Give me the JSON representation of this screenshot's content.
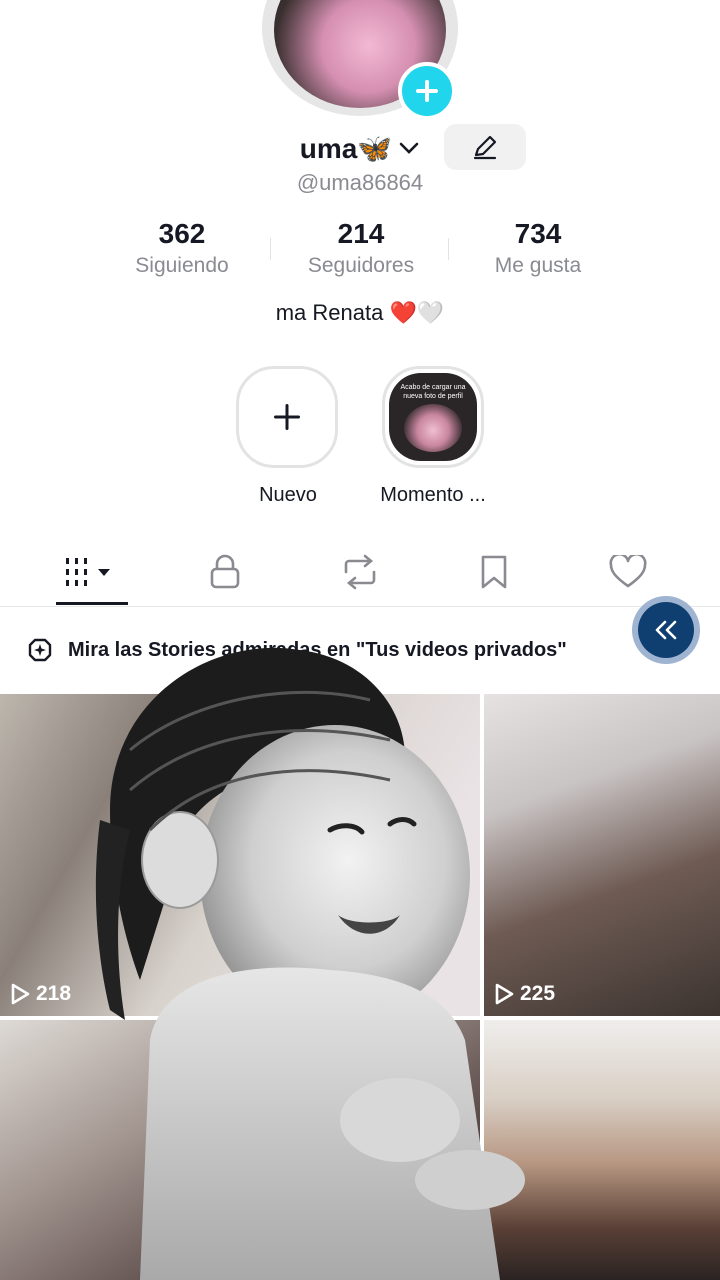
{
  "profile": {
    "username": "uma🦋",
    "handle": "@uma86864",
    "bio": "ma Renata ❤️🤍"
  },
  "stats": [
    {
      "value": "362",
      "label": "Siguiendo"
    },
    {
      "value": "214",
      "label": "Seguidores"
    },
    {
      "value": "734",
      "label": "Me gusta"
    }
  ],
  "stories": {
    "new_label": "Nuevo",
    "moment_label": "Momento ...",
    "moment_caption": "Acabo de cargar una nueva foto de perfil"
  },
  "tabs": [
    {
      "icon": "grid-icon",
      "active": true
    },
    {
      "icon": "lock-icon",
      "active": false
    },
    {
      "icon": "repost-icon",
      "active": false
    },
    {
      "icon": "bookmark-icon",
      "active": false
    },
    {
      "icon": "heart-icon",
      "active": false
    }
  ],
  "banner": {
    "text": "Mira las Stories admiradas en \"Tus videos privados\""
  },
  "videos": [
    {
      "views": "218"
    },
    {
      "views": "225"
    }
  ],
  "colors": {
    "accent": "#20d5ec",
    "fab": "#0f3f70"
  }
}
